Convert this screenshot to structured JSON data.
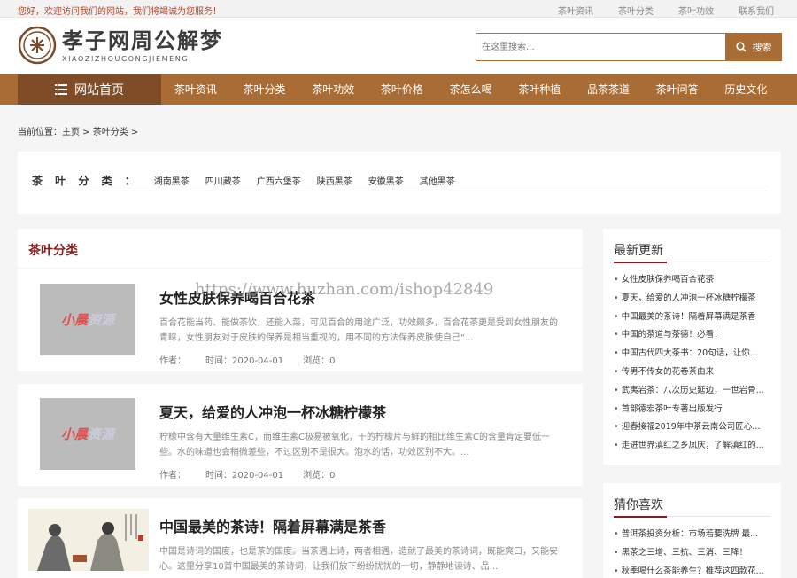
{
  "topbar": {
    "welcome": "您好，欢迎访问我们的网站，我们将竭诚为您服务！",
    "links": [
      "茶叶资讯",
      "茶叶分类",
      "茶叶功效",
      "联系我们"
    ]
  },
  "logo": {
    "title": "孝子网周公解梦",
    "subtitle": "XIAOZIZHOUGONGJIEMENG"
  },
  "search": {
    "placeholder": "在这里搜索...",
    "button": "搜索"
  },
  "nav": {
    "home": "网站首页",
    "items": [
      "茶叶资讯",
      "茶叶分类",
      "茶叶功效",
      "茶叶价格",
      "茶怎么喝",
      "茶叶种植",
      "品茶茶道",
      "茶叶问答",
      "历史文化"
    ]
  },
  "breadcrumb": "当前位置：主页 > 茶叶分类 >",
  "category": {
    "label": "茶 叶 分 类 ：",
    "items": [
      "湖南黑茶",
      "四川藏茶",
      "广西六堡茶",
      "陕西黑茶",
      "安徽黑茶",
      "其他黑茶"
    ]
  },
  "list": {
    "title": "茶叶分类",
    "articles": [
      {
        "title": "女性皮肤保养喝百合花茶",
        "desc": "百合花能当药、能做茶饮，还能入菜，可见百合的用途广泛，功效颇多，百合花茶更是受到女性朋友的青睐，女性朋友对于皮肤的保养是相当重视的，用不同的方法保养皮肤使自己“...",
        "author": "作者：",
        "date": "时间：2020-04-01",
        "views": "浏览：0"
      },
      {
        "title": "夏天，给爱的人冲泡一杯冰糖柠檬茶",
        "desc": "柠檬中含有大量维生素C，而维生素C极易被氧化，干的柠檬片与鲜的相比维生素C的含量肯定要低一些。水的味道也会稍微差些，不过区别不是很大。泡水的话，功效区别不大。...",
        "author": "作者：",
        "date": "时间：2020-04-01",
        "views": "浏览：0"
      },
      {
        "title": "中国最美的茶诗！隔着屏幕满是茶香",
        "desc": "中国是诗词的国度，也是茶的国度。当茶遇上诗，两者相遇，造就了最美的茶诗词，既能爽口，又能安心。这里分享10首中国最美的茶诗词，让我们放下纷纷扰扰的一切，静静地读诗、品..."
      }
    ]
  },
  "thumb_watermark": {
    "prefix": "小晨",
    "suffix": "资源"
  },
  "latest": {
    "title": "最新更新",
    "items": [
      "女性皮肤保养喝百合花茶",
      "夏天，给爱的人冲泡一杯冰糖柠檬茶",
      "中国最美的茶诗！隔着屏幕满是茶香",
      "中国的茶道与茶德！必看！",
      "中国古代四大茶书：20句话，让你...",
      "传男不传女的花卷茶由来",
      "武夷岩茶：八次历史延边，一世岩骨...",
      "首部德宏茶叶专著出版发行",
      "迎春接福2019年中茶云南公司匠心...",
      "走进世界滇红之乡凤庆，了解滇红的..."
    ]
  },
  "guess": {
    "title": "猜你喜欢",
    "items": [
      "普洱茶投资分析：市场若要洗牌 最...",
      "黑茶之三增、三抗、三消、三降！",
      "秋季喝什么茶能养生？推荐这四款花..."
    ]
  },
  "watermark": "https://www.huzhan.com/ishop42849",
  "colors": {
    "brand": "#a86c34",
    "brand_dark": "#7e4d27",
    "accent": "#8b1a1a"
  }
}
